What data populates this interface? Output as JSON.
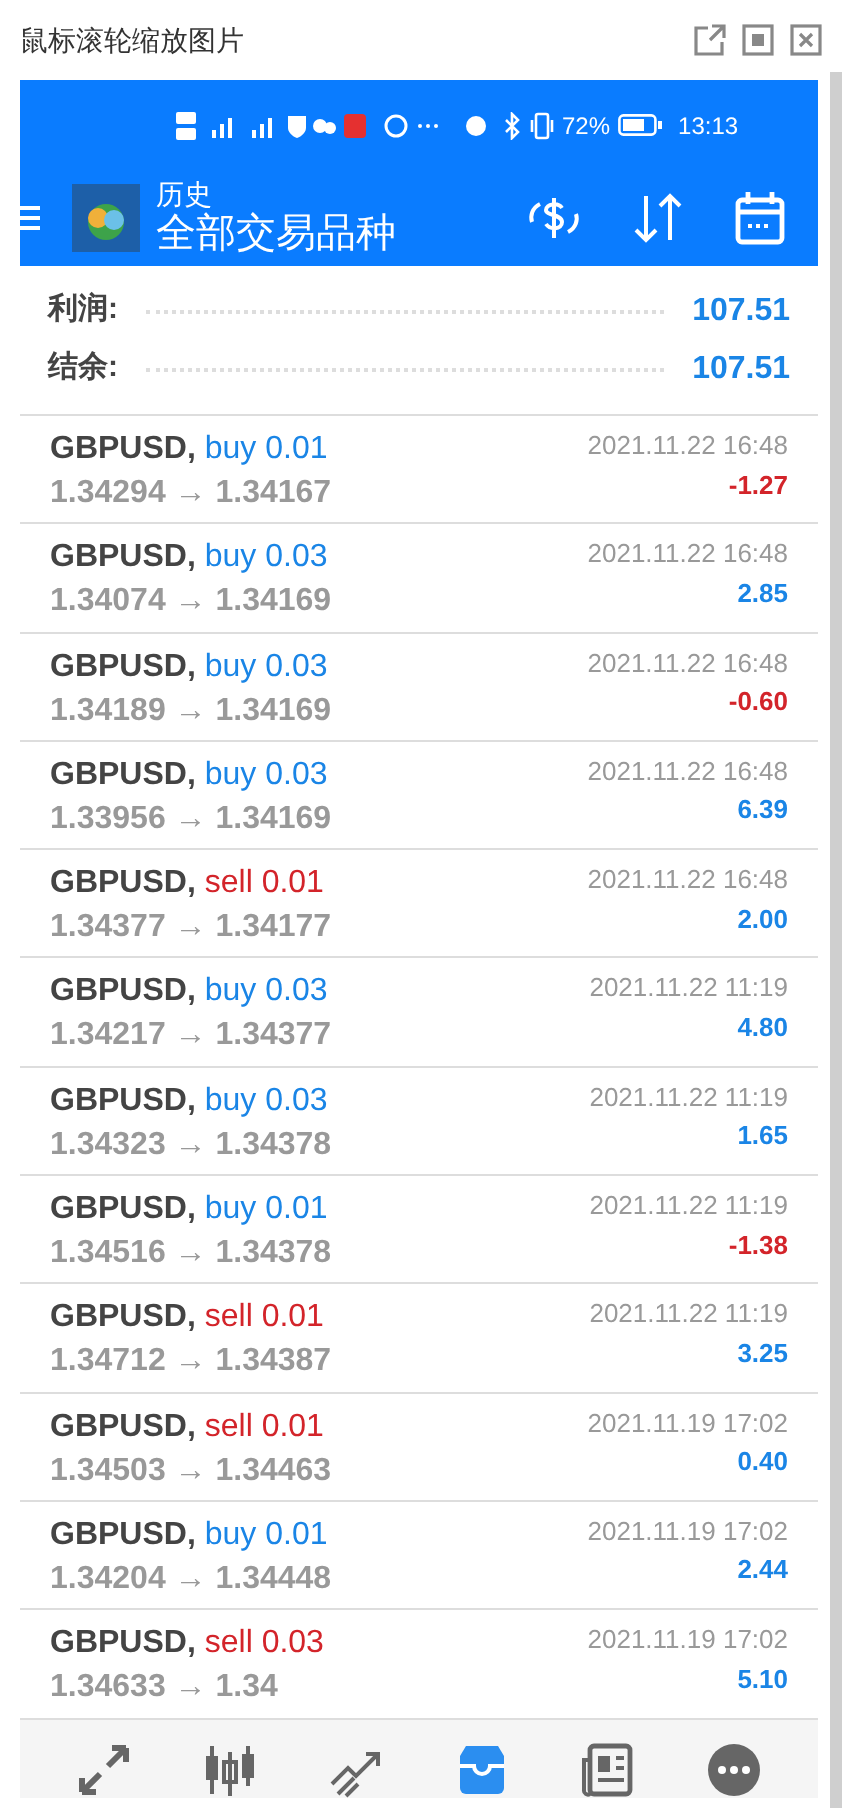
{
  "window": {
    "title": "鼠标滚轮缩放图片"
  },
  "status_bar": {
    "battery": "72%",
    "time": "13:13"
  },
  "toolbar": {
    "title": "历史",
    "subtitle": "全部交易品种"
  },
  "summary": [
    {
      "label": "利润:",
      "value": "107.51"
    },
    {
      "label": "结余:",
      "value": "107.51"
    }
  ],
  "trades": [
    {
      "symbol": "GBPUSD,",
      "kind": "buy",
      "order": "buy 0.01",
      "prices": "1.34294 → 1.34167",
      "time": "2021.11.22 16:48",
      "profit": "-1.27",
      "negative": true
    },
    {
      "symbol": "GBPUSD,",
      "kind": "buy",
      "order": "buy 0.03",
      "prices": "1.34074 → 1.34169",
      "time": "2021.11.22 16:48",
      "profit": "2.85",
      "negative": false
    },
    {
      "symbol": "GBPUSD,",
      "kind": "buy",
      "order": "buy 0.03",
      "prices": "1.34189 → 1.34169",
      "time": "2021.11.22 16:48",
      "profit": "-0.60",
      "negative": true
    },
    {
      "symbol": "GBPUSD,",
      "kind": "buy",
      "order": "buy 0.03",
      "prices": "1.33956 → 1.34169",
      "time": "2021.11.22 16:48",
      "profit": "6.39",
      "negative": false
    },
    {
      "symbol": "GBPUSD,",
      "kind": "sell",
      "order": "sell 0.01",
      "prices": "1.34377 → 1.34177",
      "time": "2021.11.22 16:48",
      "profit": "2.00",
      "negative": false
    },
    {
      "symbol": "GBPUSD,",
      "kind": "buy",
      "order": "buy 0.03",
      "prices": "1.34217 → 1.34377",
      "time": "2021.11.22 11:19",
      "profit": "4.80",
      "negative": false
    },
    {
      "symbol": "GBPUSD,",
      "kind": "buy",
      "order": "buy 0.03",
      "prices": "1.34323 → 1.34378",
      "time": "2021.11.22 11:19",
      "profit": "1.65",
      "negative": false
    },
    {
      "symbol": "GBPUSD,",
      "kind": "buy",
      "order": "buy 0.01",
      "prices": "1.34516 → 1.34378",
      "time": "2021.11.22 11:19",
      "profit": "-1.38",
      "negative": true
    },
    {
      "symbol": "GBPUSD,",
      "kind": "sell",
      "order": "sell 0.01",
      "prices": "1.34712 → 1.34387",
      "time": "2021.11.22 11:19",
      "profit": "3.25",
      "negative": false
    },
    {
      "symbol": "GBPUSD,",
      "kind": "sell",
      "order": "sell 0.01",
      "prices": "1.34503 → 1.34463",
      "time": "2021.11.19 17:02",
      "profit": "0.40",
      "negative": false
    },
    {
      "symbol": "GBPUSD,",
      "kind": "buy",
      "order": "buy 0.01",
      "prices": "1.34204 → 1.34448",
      "time": "2021.11.19 17:02",
      "profit": "2.44",
      "negative": false
    },
    {
      "symbol": "GBPUSD,",
      "kind": "sell",
      "order": "sell 0.03",
      "prices": "1.34633 → 1.34",
      "time": "2021.11.19 17:02",
      "profit": "5.10",
      "negative": false
    }
  ],
  "bottom_nav": [
    {
      "kind": "quotes",
      "selected": false
    },
    {
      "kind": "chart",
      "selected": false
    },
    {
      "kind": "trade",
      "selected": false
    },
    {
      "kind": "history",
      "selected": true
    },
    {
      "kind": "news",
      "selected": false
    },
    {
      "kind": "chat",
      "selected": false
    }
  ]
}
